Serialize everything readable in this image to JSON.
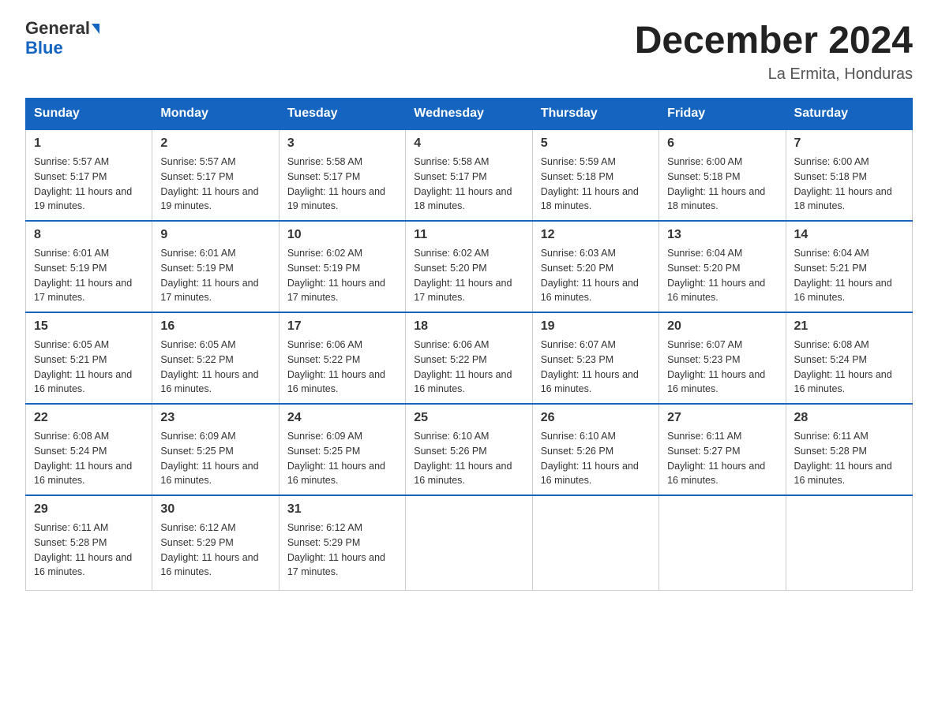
{
  "logo": {
    "line1_normal": "General",
    "line1_arrow": true,
    "line2": "Blue"
  },
  "title": "December 2024",
  "location": "La Ermita, Honduras",
  "weekdays": [
    "Sunday",
    "Monday",
    "Tuesday",
    "Wednesday",
    "Thursday",
    "Friday",
    "Saturday"
  ],
  "weeks": [
    [
      {
        "day": "1",
        "sunrise": "Sunrise: 5:57 AM",
        "sunset": "Sunset: 5:17 PM",
        "daylight": "Daylight: 11 hours and 19 minutes."
      },
      {
        "day": "2",
        "sunrise": "Sunrise: 5:57 AM",
        "sunset": "Sunset: 5:17 PM",
        "daylight": "Daylight: 11 hours and 19 minutes."
      },
      {
        "day": "3",
        "sunrise": "Sunrise: 5:58 AM",
        "sunset": "Sunset: 5:17 PM",
        "daylight": "Daylight: 11 hours and 19 minutes."
      },
      {
        "day": "4",
        "sunrise": "Sunrise: 5:58 AM",
        "sunset": "Sunset: 5:17 PM",
        "daylight": "Daylight: 11 hours and 18 minutes."
      },
      {
        "day": "5",
        "sunrise": "Sunrise: 5:59 AM",
        "sunset": "Sunset: 5:18 PM",
        "daylight": "Daylight: 11 hours and 18 minutes."
      },
      {
        "day": "6",
        "sunrise": "Sunrise: 6:00 AM",
        "sunset": "Sunset: 5:18 PM",
        "daylight": "Daylight: 11 hours and 18 minutes."
      },
      {
        "day": "7",
        "sunrise": "Sunrise: 6:00 AM",
        "sunset": "Sunset: 5:18 PM",
        "daylight": "Daylight: 11 hours and 18 minutes."
      }
    ],
    [
      {
        "day": "8",
        "sunrise": "Sunrise: 6:01 AM",
        "sunset": "Sunset: 5:19 PM",
        "daylight": "Daylight: 11 hours and 17 minutes."
      },
      {
        "day": "9",
        "sunrise": "Sunrise: 6:01 AM",
        "sunset": "Sunset: 5:19 PM",
        "daylight": "Daylight: 11 hours and 17 minutes."
      },
      {
        "day": "10",
        "sunrise": "Sunrise: 6:02 AM",
        "sunset": "Sunset: 5:19 PM",
        "daylight": "Daylight: 11 hours and 17 minutes."
      },
      {
        "day": "11",
        "sunrise": "Sunrise: 6:02 AM",
        "sunset": "Sunset: 5:20 PM",
        "daylight": "Daylight: 11 hours and 17 minutes."
      },
      {
        "day": "12",
        "sunrise": "Sunrise: 6:03 AM",
        "sunset": "Sunset: 5:20 PM",
        "daylight": "Daylight: 11 hours and 16 minutes."
      },
      {
        "day": "13",
        "sunrise": "Sunrise: 6:04 AM",
        "sunset": "Sunset: 5:20 PM",
        "daylight": "Daylight: 11 hours and 16 minutes."
      },
      {
        "day": "14",
        "sunrise": "Sunrise: 6:04 AM",
        "sunset": "Sunset: 5:21 PM",
        "daylight": "Daylight: 11 hours and 16 minutes."
      }
    ],
    [
      {
        "day": "15",
        "sunrise": "Sunrise: 6:05 AM",
        "sunset": "Sunset: 5:21 PM",
        "daylight": "Daylight: 11 hours and 16 minutes."
      },
      {
        "day": "16",
        "sunrise": "Sunrise: 6:05 AM",
        "sunset": "Sunset: 5:22 PM",
        "daylight": "Daylight: 11 hours and 16 minutes."
      },
      {
        "day": "17",
        "sunrise": "Sunrise: 6:06 AM",
        "sunset": "Sunset: 5:22 PM",
        "daylight": "Daylight: 11 hours and 16 minutes."
      },
      {
        "day": "18",
        "sunrise": "Sunrise: 6:06 AM",
        "sunset": "Sunset: 5:22 PM",
        "daylight": "Daylight: 11 hours and 16 minutes."
      },
      {
        "day": "19",
        "sunrise": "Sunrise: 6:07 AM",
        "sunset": "Sunset: 5:23 PM",
        "daylight": "Daylight: 11 hours and 16 minutes."
      },
      {
        "day": "20",
        "sunrise": "Sunrise: 6:07 AM",
        "sunset": "Sunset: 5:23 PM",
        "daylight": "Daylight: 11 hours and 16 minutes."
      },
      {
        "day": "21",
        "sunrise": "Sunrise: 6:08 AM",
        "sunset": "Sunset: 5:24 PM",
        "daylight": "Daylight: 11 hours and 16 minutes."
      }
    ],
    [
      {
        "day": "22",
        "sunrise": "Sunrise: 6:08 AM",
        "sunset": "Sunset: 5:24 PM",
        "daylight": "Daylight: 11 hours and 16 minutes."
      },
      {
        "day": "23",
        "sunrise": "Sunrise: 6:09 AM",
        "sunset": "Sunset: 5:25 PM",
        "daylight": "Daylight: 11 hours and 16 minutes."
      },
      {
        "day": "24",
        "sunrise": "Sunrise: 6:09 AM",
        "sunset": "Sunset: 5:25 PM",
        "daylight": "Daylight: 11 hours and 16 minutes."
      },
      {
        "day": "25",
        "sunrise": "Sunrise: 6:10 AM",
        "sunset": "Sunset: 5:26 PM",
        "daylight": "Daylight: 11 hours and 16 minutes."
      },
      {
        "day": "26",
        "sunrise": "Sunrise: 6:10 AM",
        "sunset": "Sunset: 5:26 PM",
        "daylight": "Daylight: 11 hours and 16 minutes."
      },
      {
        "day": "27",
        "sunrise": "Sunrise: 6:11 AM",
        "sunset": "Sunset: 5:27 PM",
        "daylight": "Daylight: 11 hours and 16 minutes."
      },
      {
        "day": "28",
        "sunrise": "Sunrise: 6:11 AM",
        "sunset": "Sunset: 5:28 PM",
        "daylight": "Daylight: 11 hours and 16 minutes."
      }
    ],
    [
      {
        "day": "29",
        "sunrise": "Sunrise: 6:11 AM",
        "sunset": "Sunset: 5:28 PM",
        "daylight": "Daylight: 11 hours and 16 minutes."
      },
      {
        "day": "30",
        "sunrise": "Sunrise: 6:12 AM",
        "sunset": "Sunset: 5:29 PM",
        "daylight": "Daylight: 11 hours and 16 minutes."
      },
      {
        "day": "31",
        "sunrise": "Sunrise: 6:12 AM",
        "sunset": "Sunset: 5:29 PM",
        "daylight": "Daylight: 11 hours and 17 minutes."
      },
      null,
      null,
      null,
      null
    ]
  ]
}
